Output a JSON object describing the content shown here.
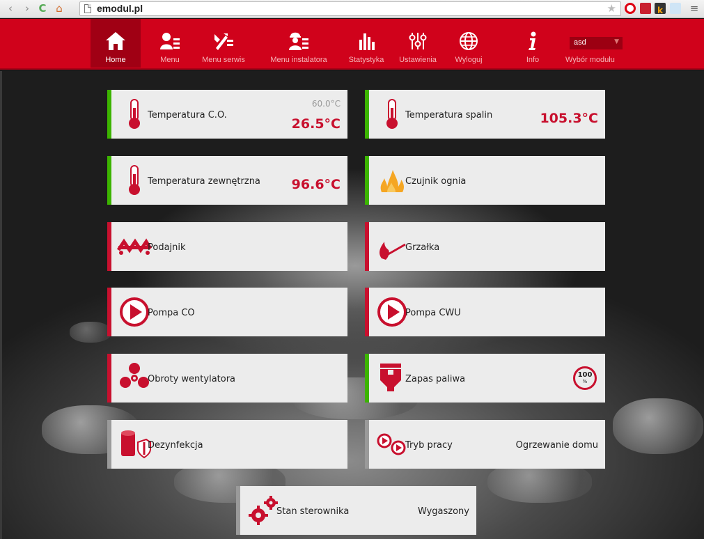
{
  "browser": {
    "url": "emodul.pl"
  },
  "nav": {
    "items": [
      {
        "label": "Home",
        "icon": "home-icon"
      },
      {
        "label": "Menu",
        "icon": "user-menu-icon"
      },
      {
        "label": "Menu serwis",
        "icon": "tools-menu-icon"
      },
      {
        "label": "Menu instalatora",
        "icon": "installer-icon"
      },
      {
        "label": "Statystyka",
        "icon": "bar-chart-icon"
      },
      {
        "label": "Ustawienia",
        "icon": "sliders-icon"
      },
      {
        "label": "Wyloguj",
        "icon": "globe-icon"
      },
      {
        "label": "Info",
        "icon": "info-icon"
      }
    ],
    "module_select": {
      "value": "asd",
      "label": "Wybór modułu"
    }
  },
  "tiles": {
    "temp_co": {
      "name": "Temperatura C.O.",
      "setpoint": "60.0°C",
      "value": "26.5°C"
    },
    "temp_spalin": {
      "name": "Temperatura spalin",
      "value": "105.3°C"
    },
    "temp_zew": {
      "name": "Temperatura zewnętrzna",
      "value": "96.6°C"
    },
    "czujnik": {
      "name": "Czujnik ognia"
    },
    "podajnik": {
      "name": "Podajnik"
    },
    "grzalka": {
      "name": "Grzałka"
    },
    "pompa_co": {
      "name": "Pompa CO"
    },
    "pompa_cwu": {
      "name": "Pompa CWU"
    },
    "obroty": {
      "name": "Obroty wentylatora"
    },
    "zapas": {
      "name": "Zapas paliwa",
      "level": "100",
      "unit": "%"
    },
    "dezynfekcja": {
      "name": "Dezynfekcja"
    },
    "tryb": {
      "name": "Tryb pracy",
      "value": "Ogrzewanie domu"
    },
    "stan": {
      "name": "Stan sterownika",
      "value": "Wygaszony"
    }
  },
  "colors": {
    "brand_red": "#d0021b",
    "value_red": "#c8102e",
    "ok_green": "#3cb400",
    "tile_bg": "#ececec"
  }
}
